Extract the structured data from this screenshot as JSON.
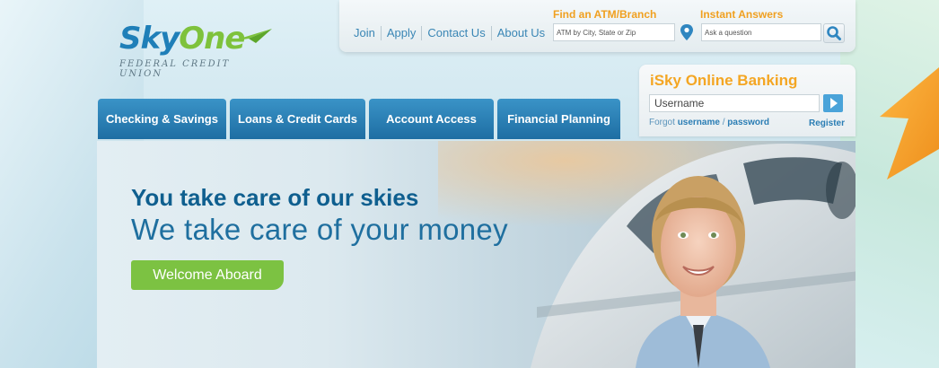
{
  "logo": {
    "brand_sky": "Sky",
    "brand_one": "One",
    "subtitle": "FEDERAL CREDIT UNION"
  },
  "utility": {
    "links": [
      "Join",
      "Apply",
      "Contact Us",
      "About Us"
    ],
    "atm_label": "Find an ATM/Branch",
    "atm_placeholder": "ATM by City, State or Zip",
    "answers_label": "Instant Answers",
    "answers_placeholder": "Ask a question"
  },
  "banking": {
    "title": "iSky Online Banking",
    "username_placeholder": "Username",
    "forgot_prefix": "Forgot",
    "forgot_username": "username",
    "forgot_sep": " / ",
    "forgot_password": "password",
    "register": "Register"
  },
  "nav": {
    "tabs": [
      "Checking & Savings",
      "Loans & Credit Cards",
      "Account Access",
      "Financial Planning"
    ]
  },
  "hero": {
    "title1": "You take care of our skies",
    "title2": "We take care of your money",
    "cta": "Welcome Aboard"
  },
  "colors": {
    "brand_blue": "#1f7fb8",
    "brand_green": "#7ec23c",
    "accent_orange": "#f4a623",
    "nav_blue": "#2a80b6"
  }
}
